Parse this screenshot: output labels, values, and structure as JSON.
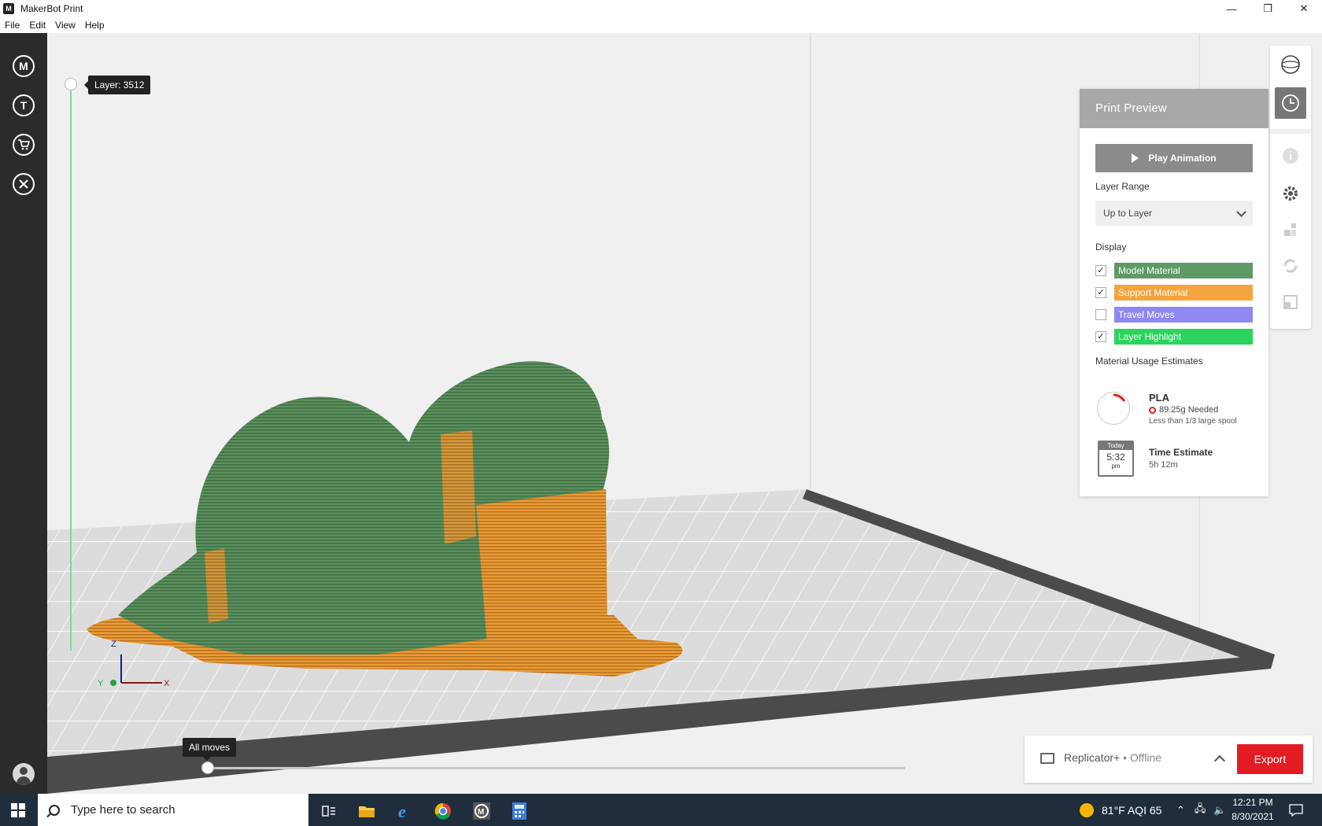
{
  "window": {
    "title": "MakerBot Print",
    "app_icon": "M",
    "minimize": "—",
    "maximize": "❐",
    "close": "✕"
  },
  "menu": [
    "File",
    "Edit",
    "View",
    "Help"
  ],
  "sidebar": {
    "items": [
      {
        "name": "makerbot-home-icon",
        "glyph": "M"
      },
      {
        "name": "thingiverse-icon",
        "glyph": "T"
      },
      {
        "name": "store-cart-icon",
        "glyph": "🛒"
      },
      {
        "name": "tools-icon",
        "glyph": "✕"
      }
    ]
  },
  "viewport": {
    "layer_label": "Layer: 3512",
    "moves_label": "All moves",
    "axes": {
      "z": "Z",
      "y": "Y",
      "x": "X"
    }
  },
  "preview_panel": {
    "title": "Print Preview",
    "play_label": "Play Animation",
    "layer_range_label": "Layer Range",
    "layer_range_value": "Up to Layer",
    "display_label": "Display",
    "display_items": [
      {
        "label": "Model Material",
        "checked": true,
        "color": "#5e9a66"
      },
      {
        "label": "Support Material",
        "checked": true,
        "color": "#f3a43e"
      },
      {
        "label": "Travel Moves",
        "checked": false,
        "color": "#8f88f2"
      },
      {
        "label": "Layer Highlight",
        "checked": true,
        "color": "#2bd45c"
      }
    ],
    "material_label": "Material Usage Estimates",
    "material_name": "PLA",
    "material_needed": "89.25g  Needed",
    "material_spool": "Less than 1/3 large spool",
    "calendar_top": "Today",
    "calendar_time": "5:32",
    "calendar_ampm": "pm",
    "time_label": "Time Estimate",
    "time_value": "5h 12m"
  },
  "printer": {
    "name": "Replicator+",
    "status": " • Offline",
    "export_label": "Export"
  },
  "taskbar": {
    "search_placeholder": "Type here to search",
    "weather": "81°F  AQI 65",
    "time": "12:21 PM",
    "date": "8/30/2021"
  },
  "colors": {
    "model": "#5e8f5e",
    "support": "#e99a35",
    "export": "#e51b23",
    "layer_track": "#7ed89a"
  }
}
